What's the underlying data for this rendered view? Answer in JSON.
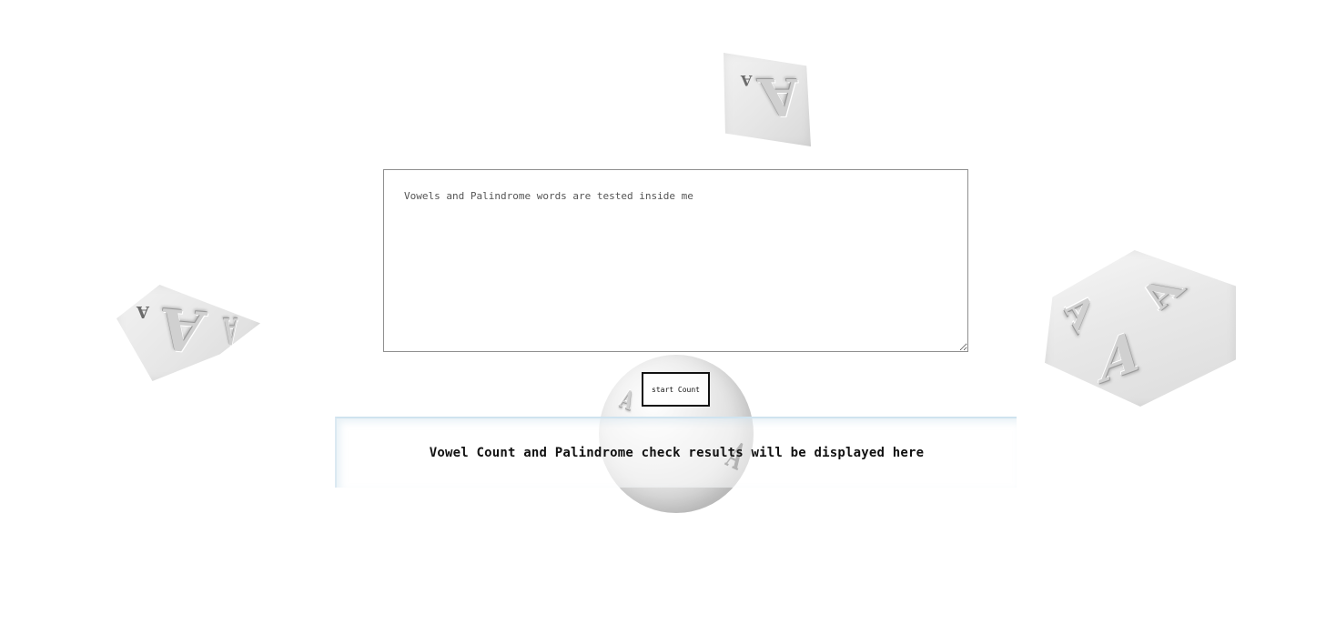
{
  "input": {
    "placeholder": "Vowels and Palindrome words are tested inside me",
    "value": ""
  },
  "button": {
    "label": "start Count"
  },
  "results": {
    "text": "Vowel Count and Palindrome check results will be displayed here"
  },
  "decorations": {
    "letter": "A",
    "small_letter": "A"
  },
  "colors": {
    "background": "#ffffff",
    "text": "#111111",
    "panel_border": "#cfe3ef"
  }
}
